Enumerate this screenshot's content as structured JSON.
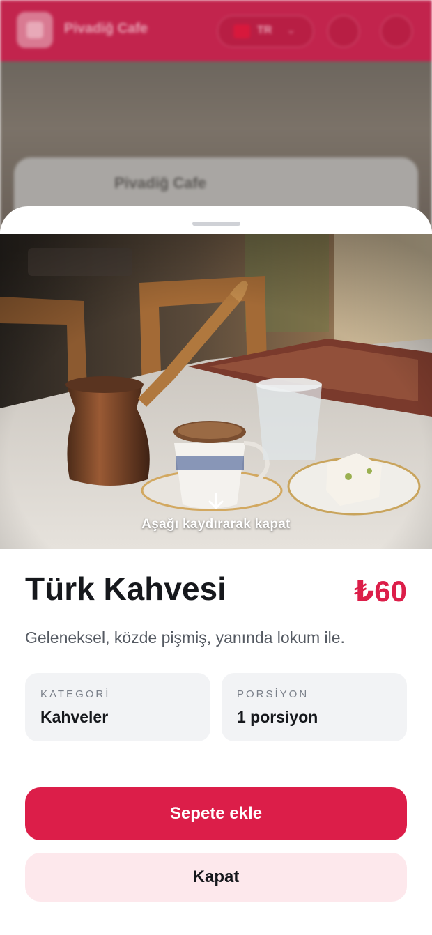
{
  "background": {
    "app_title": "Pivadiğ Cafe",
    "language_code": "TR",
    "card_title": "Pivadiğ Cafe",
    "brand_color": "#c2244d"
  },
  "sheet": {
    "swipe_hint": "Aşağı kaydırarak kapat",
    "item": {
      "name": "Türk Kahvesi",
      "price": "₺60",
      "description": "Geleneksel, közde pişmiş, yanında lokum ile."
    },
    "info": [
      {
        "label": "KATEGORİ",
        "value": "Kahveler"
      },
      {
        "label": "PORSİYON",
        "value": "1 porsiyon"
      }
    ],
    "add_to_cart_label": "Sepete ekle",
    "close_label": "Kapat",
    "accent_color": "#dc1e49"
  },
  "icons": {
    "swipe": "arrow-down-icon",
    "search": "search-icon",
    "cart": "cart-icon",
    "flag": "flag-icon"
  }
}
